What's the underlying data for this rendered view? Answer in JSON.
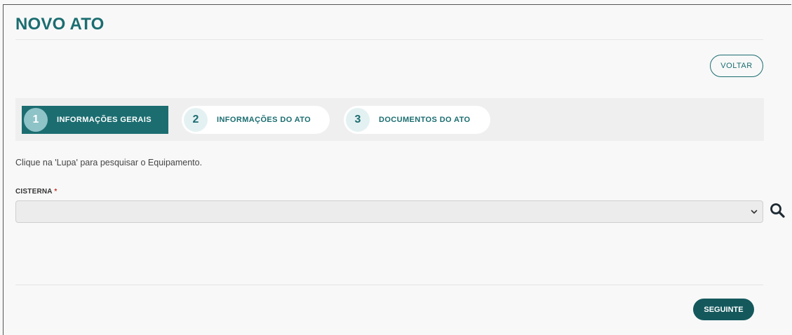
{
  "page": {
    "title": "NOVO ATO",
    "back_label": "VOLTAR",
    "next_label": "SEGUINTE"
  },
  "steps": [
    {
      "number": "1",
      "label": "INFORMAÇÕES GERAIS",
      "active": true
    },
    {
      "number": "2",
      "label": "INFORMAÇÕES DO ATO",
      "active": false
    },
    {
      "number": "3",
      "label": "DOCUMENTOS DO ATO",
      "active": false
    }
  ],
  "form": {
    "hint": "Clique na 'Lupa' para pesquisar o Equipamento.",
    "field_label": "CISTERNA",
    "required_mark": "*",
    "selected_value": ""
  },
  "icons": {
    "search": "search-icon",
    "dropdown": "chevron-down-icon"
  },
  "colors": {
    "primary": "#1b6d70",
    "primary_dark": "#14585c",
    "required": "#c0392b"
  }
}
